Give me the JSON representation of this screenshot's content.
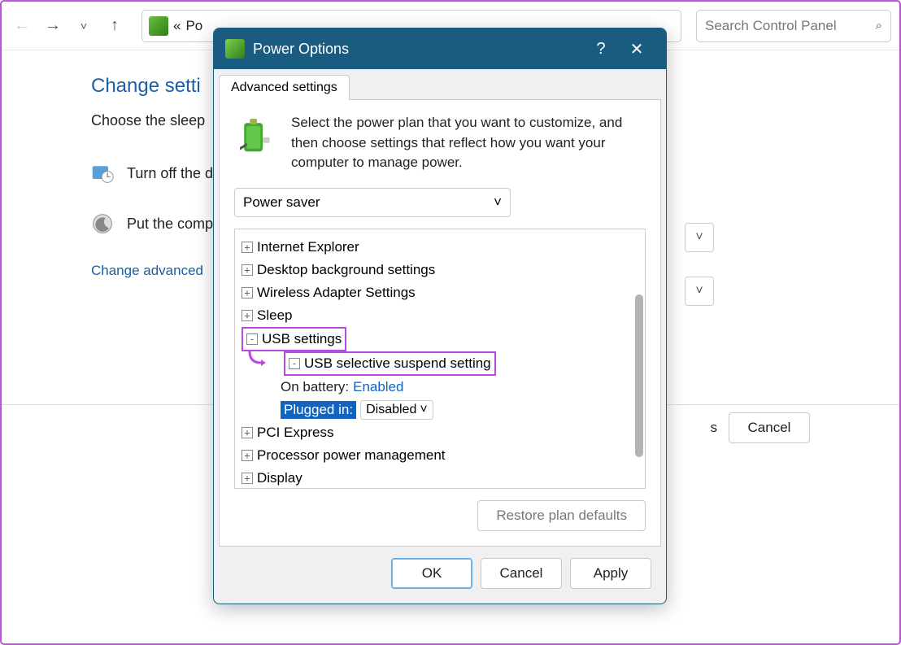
{
  "toolbar": {
    "breadcrumb_prefix": "«",
    "breadcrumb_label": "Po",
    "search_placeholder": "Search Control Panel"
  },
  "main": {
    "heading": "Change setti",
    "subtitle": "Choose the sleep",
    "rows": [
      {
        "label": "Turn off the d"
      },
      {
        "label": "Put the comp"
      }
    ],
    "advanced_link": "Change advanced",
    "cancel_button": "Cancel",
    "partial_s": "s"
  },
  "dialog": {
    "title": "Power Options",
    "tab_label": "Advanced settings",
    "intro_text": "Select the power plan that you want to customize, and then choose settings that reflect how you want your computer to manage power.",
    "plan_selected": "Power saver",
    "tree": {
      "items": [
        {
          "label": "Internet Explorer",
          "exp": "+"
        },
        {
          "label": "Desktop background settings",
          "exp": "+"
        },
        {
          "label": "Wireless Adapter Settings",
          "exp": "+"
        },
        {
          "label": "Sleep",
          "exp": "+"
        },
        {
          "label": "USB settings",
          "exp": "-"
        },
        {
          "label": "USB selective suspend setting",
          "exp": "-"
        },
        {
          "label": "PCI Express",
          "exp": "+"
        },
        {
          "label": "Processor power management",
          "exp": "+"
        },
        {
          "label": "Display",
          "exp": "+"
        }
      ],
      "on_battery_label": "On battery:",
      "on_battery_value": "Enabled",
      "plugged_in_label": "Plugged in:",
      "plugged_in_value": "Disabled"
    },
    "restore_defaults": "Restore plan defaults",
    "ok": "OK",
    "cancel": "Cancel",
    "apply": "Apply"
  }
}
